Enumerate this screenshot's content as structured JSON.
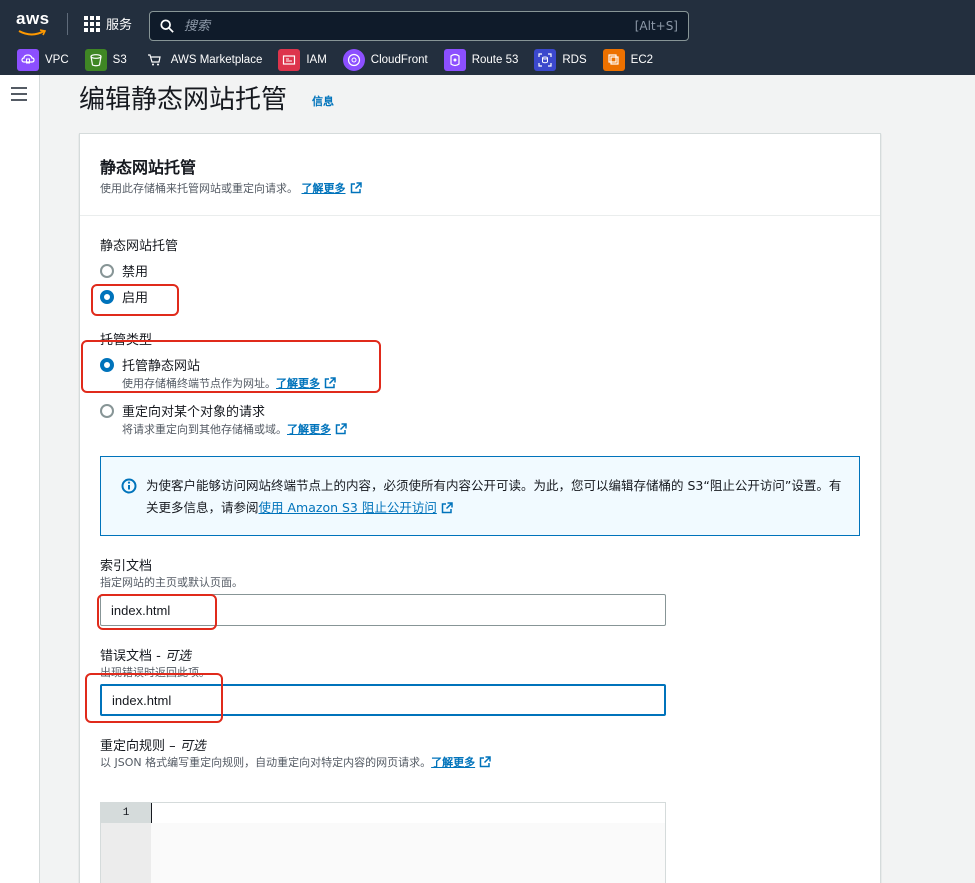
{
  "topbar": {
    "logo": "aws",
    "services_label": "服务",
    "search_placeholder": "搜索",
    "search_shortcut": "[Alt+S]"
  },
  "favorites": [
    {
      "label": "VPC",
      "icon": "vpc-icon",
      "color": "#8c4fff"
    },
    {
      "label": "S3",
      "icon": "s3-icon",
      "color": "#3f8624"
    },
    {
      "label": "AWS Marketplace",
      "icon": "cart-icon",
      "color": ""
    },
    {
      "label": "IAM",
      "icon": "iam-icon",
      "color": "#dd344c"
    },
    {
      "label": "CloudFront",
      "icon": "cloudfront-icon",
      "color": "#8c4fff"
    },
    {
      "label": "Route 53",
      "icon": "route53-icon",
      "color": "#8c4fff"
    },
    {
      "label": "RDS",
      "icon": "rds-icon",
      "color": "#3b48cc"
    },
    {
      "label": "EC2",
      "icon": "ec2-icon",
      "color": "#ed7100"
    }
  ],
  "page": {
    "title": "编辑静态网站托管",
    "info": "信息"
  },
  "panel": {
    "title": "静态网站托管",
    "desc": "使用此存储桶来托管网站或重定向请求。",
    "learn_more": "了解更多"
  },
  "hosting": {
    "label": "静态网站托管",
    "options": [
      {
        "label": "禁用",
        "checked": false
      },
      {
        "label": "启用",
        "checked": true
      }
    ]
  },
  "hosting_type": {
    "label": "托管类型",
    "options": [
      {
        "label": "托管静态网站",
        "desc": "使用存储桶终端节点作为网址。",
        "link": "了解更多",
        "checked": true
      },
      {
        "label": "重定向对某个对象的请求",
        "desc": "将请求重定向到其他存储桶或域。",
        "link": "了解更多",
        "checked": false
      }
    ]
  },
  "alert": {
    "text": "为使客户能够访问网站终端节点上的内容，必须使所有内容公开可读。为此，您可以编辑存储桶的 S3“阻止公开访问”设置。有关更多信息，请参阅",
    "link": "使用 Amazon S3 阻止公开访问"
  },
  "index_doc": {
    "label": "索引文档",
    "hint": "指定网站的主页或默认页面。",
    "value": "index.html"
  },
  "error_doc": {
    "label": "错误文档",
    "optional": "可选",
    "hint": "出现错误时返回此项。",
    "value": "index.html"
  },
  "redirect_rules": {
    "label": "重定向规则",
    "optional": "可选",
    "hint": "以 JSON 格式编写重定向规则，自动重定向对特定内容的网页请求。",
    "link": "了解更多",
    "line_number": "1"
  },
  "colors": {
    "nav_bg": "#232f3e",
    "link": "#0073bb",
    "highlight": "#e02a1b"
  }
}
